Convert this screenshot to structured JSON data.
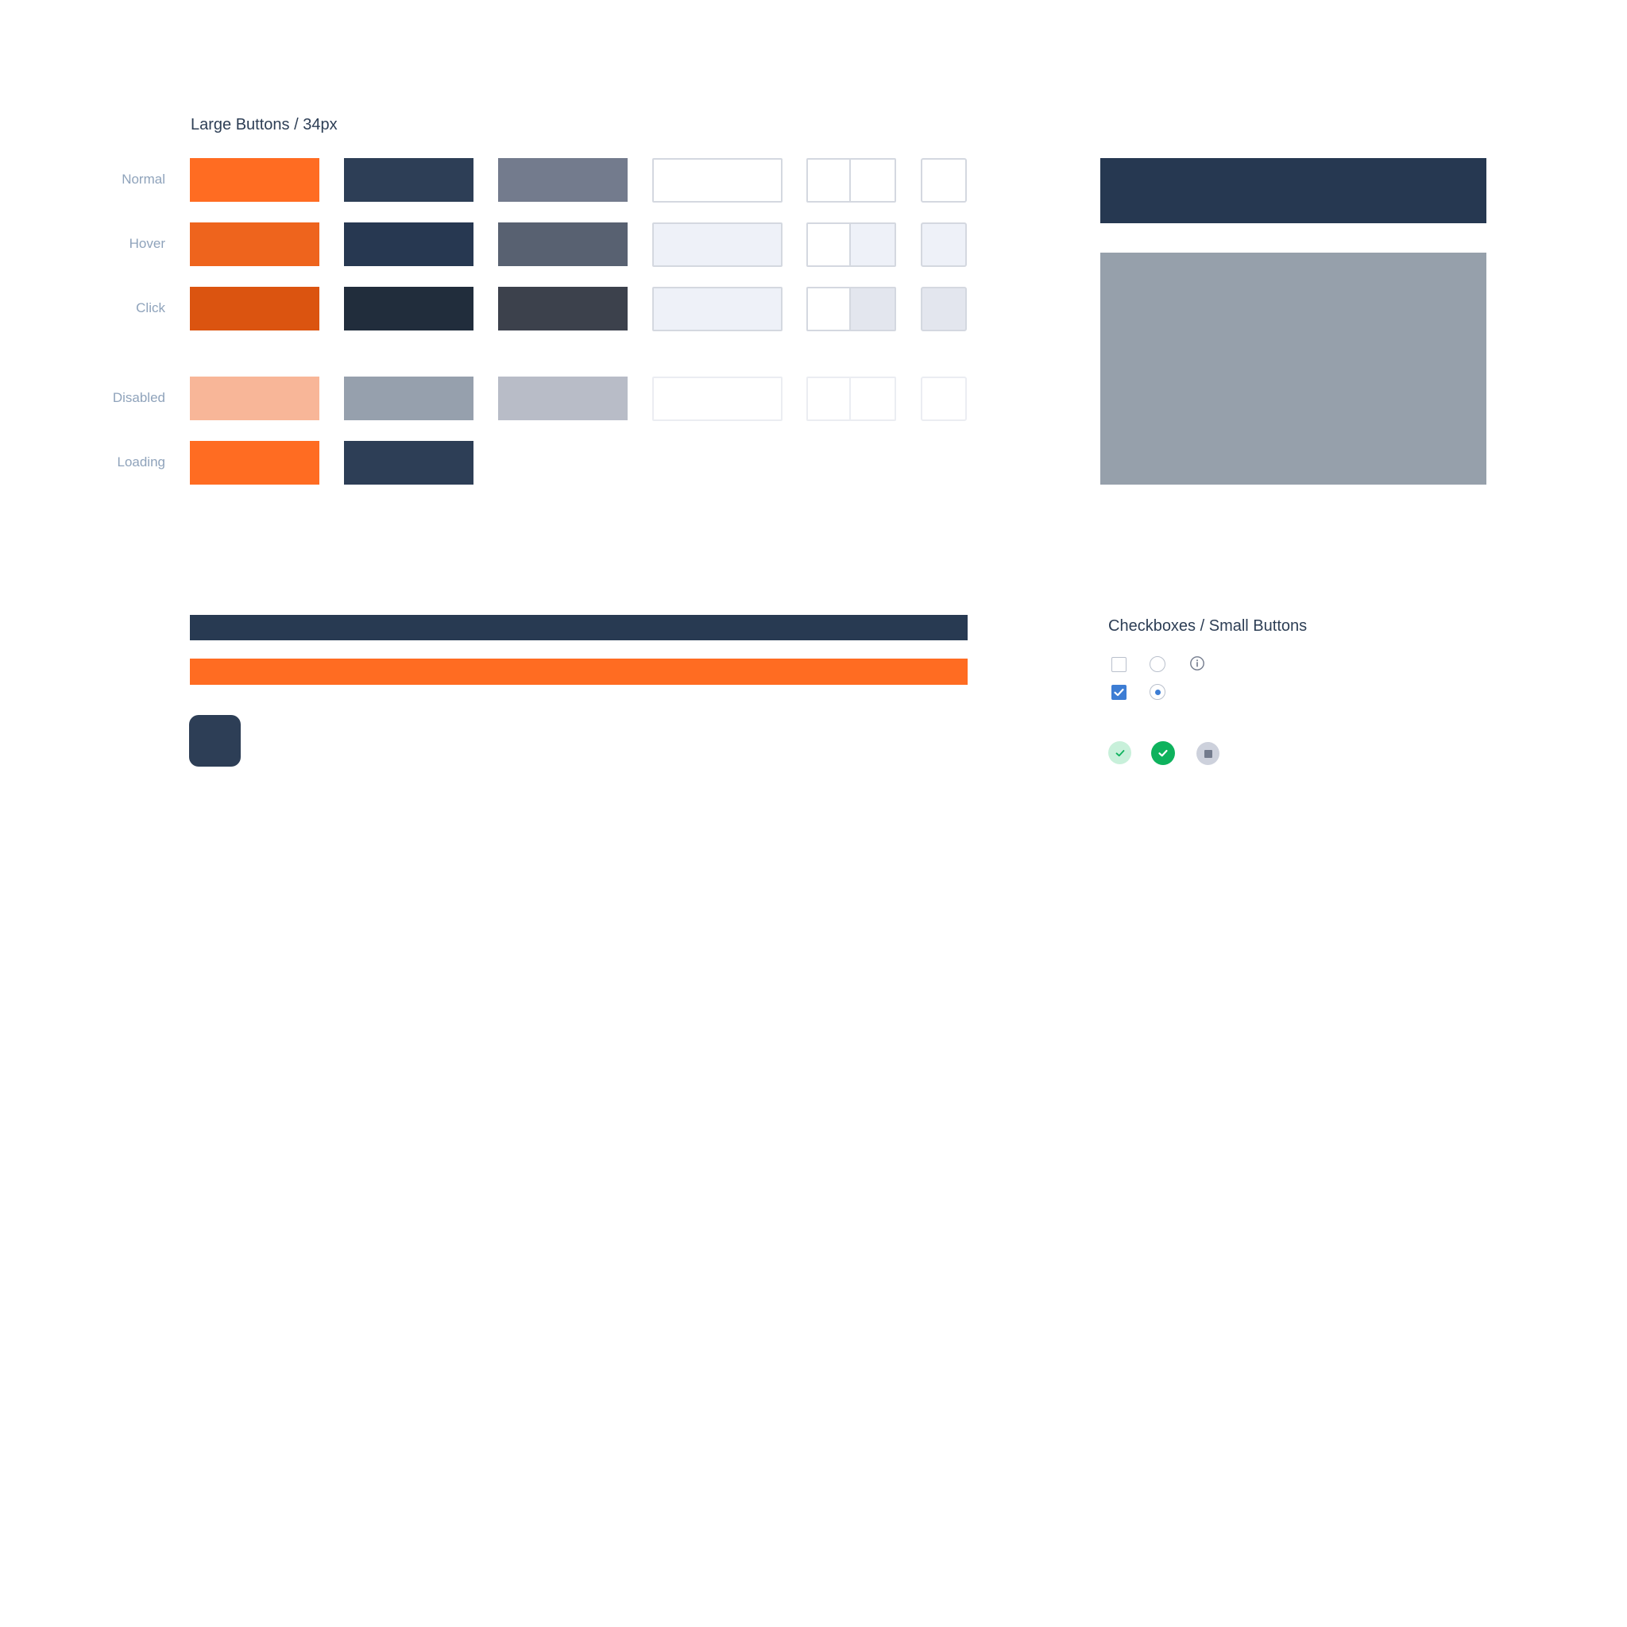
{
  "headings": {
    "large_buttons": "Large Buttons / 34px",
    "checkboxes": "Checkboxes / Small Buttons"
  },
  "states": {
    "normal": "Normal",
    "hover": "Hover",
    "click": "Click",
    "disabled": "Disabled",
    "loading": "Loading"
  },
  "colors": {
    "primary": "#ff6c22",
    "primary_hover": "#ee641d",
    "primary_click": "#db5410",
    "primary_disabled": "#f8b698",
    "secondary": "#2d3e56",
    "secondary_hover": "#273851",
    "secondary_click": "#212d3c",
    "secondary_disabled": "#96a0ad",
    "tertiary": "#737b8d",
    "tertiary_hover": "#586171",
    "tertiary_click": "#3c414c",
    "tertiary_disabled": "#b8bcc7",
    "outline_border": "#d4d8e0",
    "outline_hover_fill": "#eef1f8",
    "outline_click_fill": "#e3e6ee",
    "checkbox_checked": "#3d7dd4",
    "success": "#0eb25d",
    "success_light": "#c8f0da",
    "neutral_chip": "#cdd1dc"
  },
  "icons": {
    "checkbox_unchecked": "checkbox-unchecked-icon",
    "checkbox_checked": "checkbox-checked-icon",
    "radio_unchecked": "radio-unchecked-icon",
    "radio_checked": "radio-checked-icon",
    "info": "info-icon",
    "check_light": "check-circle-light-icon",
    "check_filled": "check-circle-filled-icon",
    "stop": "stop-circle-icon"
  }
}
